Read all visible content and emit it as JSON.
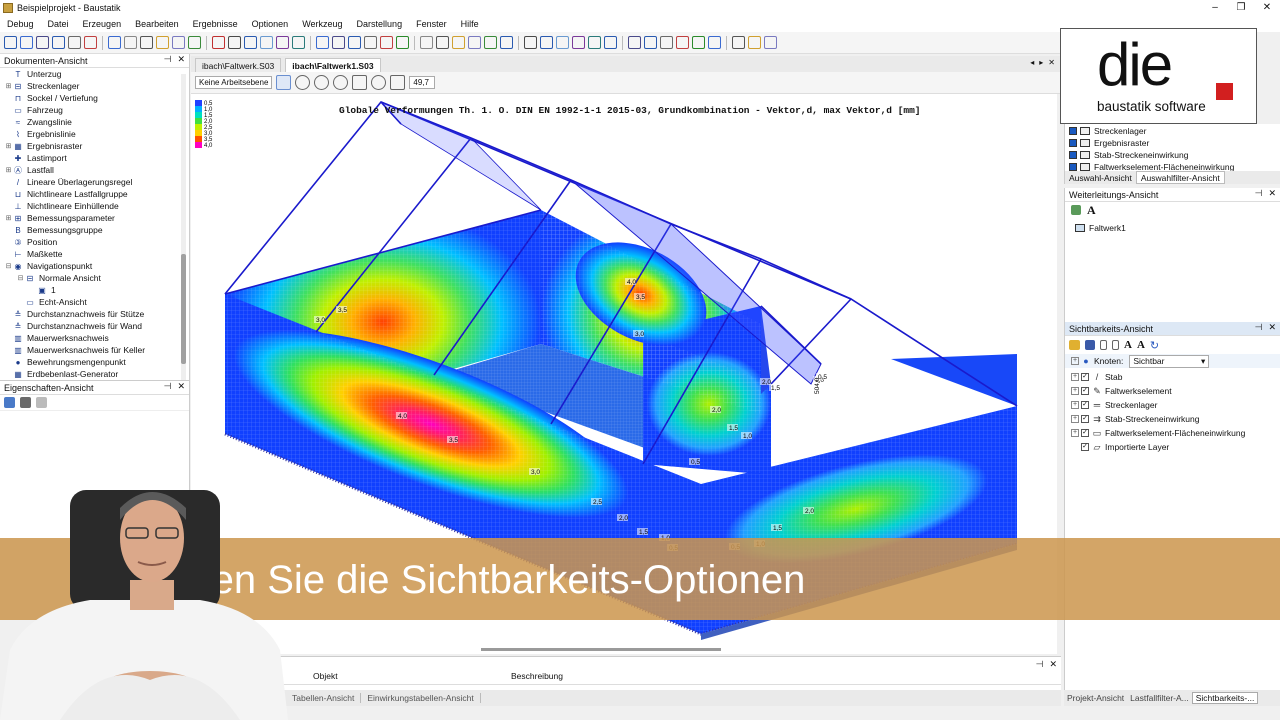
{
  "window": {
    "title": "Beispielprojekt - Baustatik",
    "controls": [
      "–",
      "❐",
      "✕"
    ]
  },
  "menu": [
    "Debug",
    "Datei",
    "Erzeugen",
    "Bearbeiten",
    "Ergebnisse",
    "Optionen",
    "Werkzeug",
    "Darstellung",
    "Fenster",
    "Hilfe"
  ],
  "doc_panel": {
    "title": "Dokumenten-Ansicht",
    "items": [
      {
        "label": "Unterzug",
        "icon": "T",
        "indent": 1
      },
      {
        "label": "Streckenlager",
        "icon": "⊟",
        "indent": 1,
        "exp": "+"
      },
      {
        "label": "Sockel / Vertiefung",
        "icon": "⊓",
        "indent": 1
      },
      {
        "label": "Fahrzeug",
        "icon": "▭",
        "indent": 1
      },
      {
        "label": "Zwangslinie",
        "icon": "≈",
        "indent": 1
      },
      {
        "label": "Ergebnislinie",
        "icon": "⌇",
        "indent": 1
      },
      {
        "label": "Ergebnisraster",
        "icon": "▦",
        "indent": 1,
        "exp": "+"
      },
      {
        "label": "Lastimport",
        "icon": "✚",
        "indent": 1
      },
      {
        "label": "Lastfall",
        "icon": "Ⓐ",
        "indent": 1,
        "exp": "+"
      },
      {
        "label": "Lineare Überlagerungsregel",
        "icon": "/",
        "indent": 1
      },
      {
        "label": "Nichtlineare Lastfallgruppe",
        "icon": "⊔",
        "indent": 1
      },
      {
        "label": "Nichtlineare Einhüllende",
        "icon": "⊥",
        "indent": 1
      },
      {
        "label": "Bemessungsparameter",
        "icon": "⊞",
        "indent": 1,
        "exp": "+"
      },
      {
        "label": "Bemessungsgruppe",
        "icon": "B",
        "indent": 1
      },
      {
        "label": "Position",
        "icon": "③",
        "indent": 1
      },
      {
        "label": "Maßkette",
        "icon": "⊢",
        "indent": 1
      },
      {
        "label": "Navigationspunkt",
        "icon": "◉",
        "indent": 1,
        "exp": "−"
      },
      {
        "label": "Normale Ansicht",
        "icon": "⊟",
        "indent": 2,
        "exp": "−"
      },
      {
        "label": "1",
        "icon": "▣",
        "indent": 3
      },
      {
        "label": "Echt-Ansicht",
        "icon": "▭",
        "indent": 2
      },
      {
        "label": "Durchstanznachweis für Stütze",
        "icon": "≙",
        "indent": 1
      },
      {
        "label": "Durchstanznachweis für Wand",
        "icon": "≙",
        "indent": 1
      },
      {
        "label": "Mauerwerksnachweis",
        "icon": "▥",
        "indent": 1
      },
      {
        "label": "Mauerwerksnachweis für Keller",
        "icon": "▥",
        "indent": 1
      },
      {
        "label": "Bewehrungsmengenpunkt",
        "icon": "●",
        "indent": 1
      },
      {
        "label": "Erdbebenlast-Generator",
        "icon": "▦",
        "indent": 1
      }
    ]
  },
  "props_panel": {
    "title": "Eigenschaften-Ansicht"
  },
  "doc_tabs": [
    {
      "label": "ibach\\Faltwerk.S03",
      "active": false
    },
    {
      "label": "ibach\\Faltwerk1.S03",
      "active": true
    }
  ],
  "view_toolbar": {
    "work_level": "Keine Arbeitsebene",
    "zoom": "49,7"
  },
  "plot": {
    "title": "Globale Verformungen Th. 1. O. DIN EN 1992-1-1 2015-03, Grundkombination - Vektor,d, max Vektor,d [mm]",
    "legend": [
      "0,5",
      "1,0",
      "1,5",
      "2,0",
      "2,5",
      "3,0",
      "3,5",
      "4,0"
    ],
    "legend_colors": [
      "#2040ff",
      "#00b0ff",
      "#00e0c0",
      "#40e040",
      "#c0f000",
      "#ffd000",
      "#ff5000",
      "#ff00c0"
    ],
    "labels": [
      "3,0",
      "3,5",
      "4,0",
      "3,5",
      "3,0",
      "2,5",
      "2,0",
      "1,5",
      "1,0",
      "0,5",
      "4,0",
      "3,5",
      "3,0",
      "2,0",
      "1,5",
      "1,0",
      "0,5",
      "2,0",
      "1,5",
      "1,0",
      "0,5",
      "2,0",
      "1,5",
      "1,0",
      "0,5",
      "504,0"
    ]
  },
  "bottom_panel": {
    "columns": [
      "Objekt",
      "Beschreibung"
    ],
    "tabs": [
      "Tabellen-Ansicht",
      "Einwirkungstabellen-Ansicht"
    ]
  },
  "logo": {
    "main": "die",
    "sub": "baustatik software"
  },
  "auswahl_panel": {
    "items": [
      "Streckenlager",
      "Ergebnisraster",
      "Stab-Streckeneinwirkung",
      "Faltwerkselement-Flächeneinwirkung"
    ],
    "tabs": [
      "Auswahl-Ansicht",
      "Auswahlfilter-Ansicht"
    ]
  },
  "weiter_panel": {
    "title": "Weiterleitungs-Ansicht",
    "item": "Faltwerk1"
  },
  "sicht_panel": {
    "title": "Sichtbarkeits-Ansicht",
    "filter_label": "Knoten:",
    "filter_value": "Sichtbar",
    "items": [
      "Stab",
      "Faltwerkselement",
      "Streckenlager",
      "Stab-Streckeneinwirkung",
      "Faltwerkselement-Flächeneinwirkung",
      "Importierte Layer"
    ]
  },
  "right_tabs": [
    "Projekt-Ansicht",
    "Lastfallfilter-A...",
    "Sichtbarkeits-..."
  ],
  "banner": {
    "text": "So nutzen Sie die Sichtbarkeits-Optionen"
  }
}
